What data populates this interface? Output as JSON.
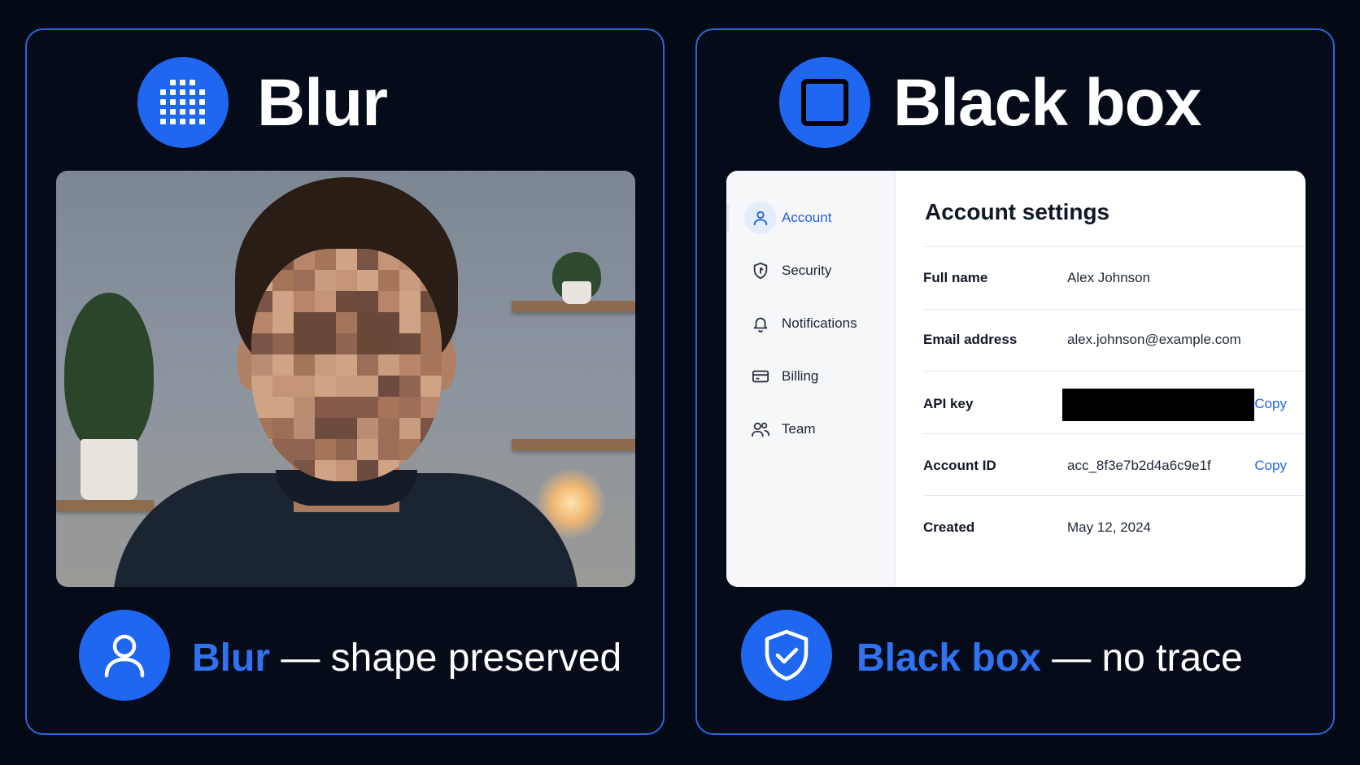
{
  "left_panel": {
    "title": "Blur",
    "header_icon": "grid-mosaic-icon",
    "caption_accent": "Blur",
    "caption_rest": " — shape preserved",
    "caption_icon": "user-icon"
  },
  "right_panel": {
    "title": "Black box",
    "header_icon": "square-icon",
    "caption_accent": "Black box",
    "caption_rest": " — no trace",
    "caption_icon": "shield-check-icon"
  },
  "settings": {
    "nav": [
      {
        "label": "Account",
        "icon": "user-icon",
        "active": true
      },
      {
        "label": "Security",
        "icon": "shield-icon",
        "active": false
      },
      {
        "label": "Notifications",
        "icon": "bell-icon",
        "active": false
      },
      {
        "label": "Billing",
        "icon": "card-icon",
        "active": false
      },
      {
        "label": "Team",
        "icon": "users-icon",
        "active": false
      }
    ],
    "title": "Account settings",
    "rows": [
      {
        "label": "Full name",
        "value": "Alex Johnson"
      },
      {
        "label": "Email address",
        "value": "alex.johnson@example.com"
      },
      {
        "label": "API key",
        "value": "",
        "redacted": true,
        "action": "Copy"
      },
      {
        "label": "Account ID",
        "value": "acc_8f3e7b2d4a6c9e1f",
        "action": "Copy"
      },
      {
        "label": "Created",
        "value": "May 12, 2024"
      }
    ]
  },
  "colors": {
    "accent": "#1f67f0",
    "panel_border": "#2f66d6",
    "background": "#050a17",
    "redaction": "#000000"
  }
}
